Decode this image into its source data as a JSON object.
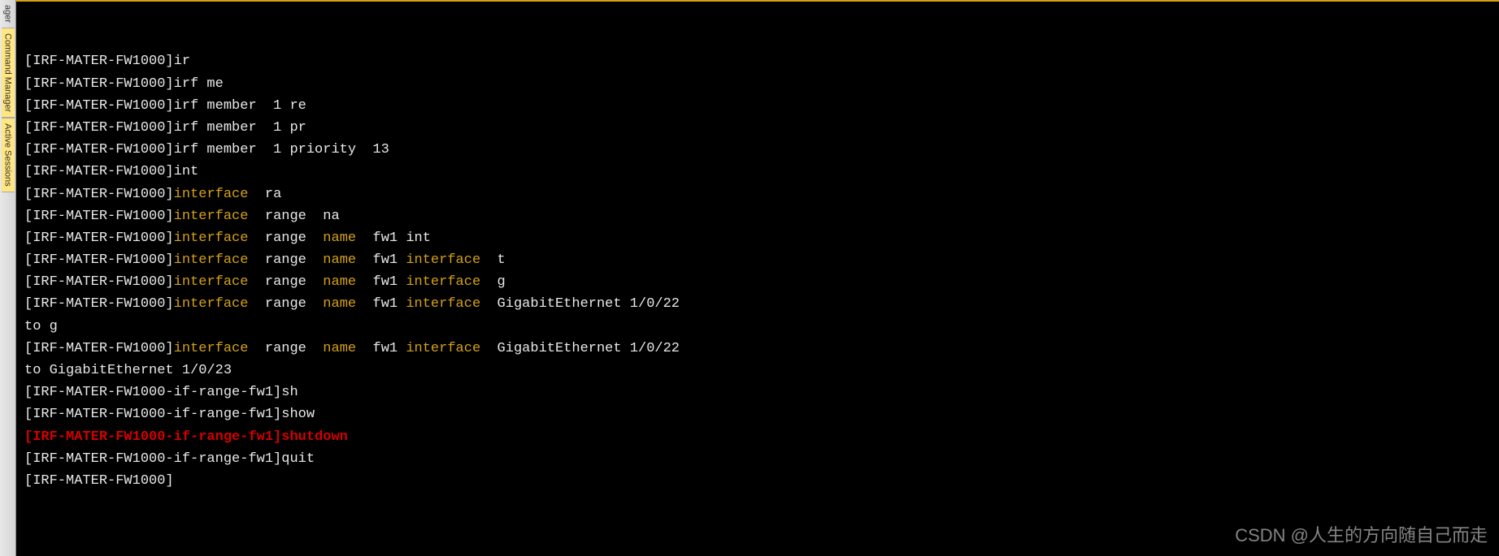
{
  "sidebar": {
    "tabs": [
      {
        "label": "Command Manager",
        "active": true,
        "top_fragment": "ager"
      },
      {
        "label": "Active Sessions",
        "active": true
      }
    ]
  },
  "prompts": {
    "main": "[IRF-MATER-FW1000]",
    "ifrange": "[IRF-MATER-FW1000-if-range-fw1]"
  },
  "terminal": {
    "lines": [
      {
        "segments": [
          {
            "t": "plain",
            "v": "[IRF-MATER-FW1000]ir"
          }
        ]
      },
      {
        "segments": [
          {
            "t": "plain",
            "v": "[IRF-MATER-FW1000]irf me"
          }
        ]
      },
      {
        "segments": [
          {
            "t": "plain",
            "v": "[IRF-MATER-FW1000]irf member  1 re"
          }
        ]
      },
      {
        "segments": [
          {
            "t": "plain",
            "v": "[IRF-MATER-FW1000]irf member  1 pr"
          }
        ]
      },
      {
        "segments": [
          {
            "t": "plain",
            "v": "[IRF-MATER-FW1000]irf member  1 priority  13"
          }
        ]
      },
      {
        "segments": [
          {
            "t": "plain",
            "v": "[IRF-MATER-FW1000]int"
          }
        ]
      },
      {
        "segments": [
          {
            "t": "plain",
            "v": "[IRF-MATER-FW1000]"
          },
          {
            "t": "kw",
            "v": "interface"
          },
          {
            "t": "plain",
            "v": "  ra"
          }
        ]
      },
      {
        "segments": [
          {
            "t": "plain",
            "v": "[IRF-MATER-FW1000]"
          },
          {
            "t": "kw",
            "v": "interface"
          },
          {
            "t": "plain",
            "v": "  range  na"
          }
        ]
      },
      {
        "segments": [
          {
            "t": "plain",
            "v": "[IRF-MATER-FW1000]"
          },
          {
            "t": "kw",
            "v": "interface"
          },
          {
            "t": "plain",
            "v": "  range  "
          },
          {
            "t": "kw",
            "v": "name"
          },
          {
            "t": "plain",
            "v": "  fw1 int"
          }
        ]
      },
      {
        "segments": [
          {
            "t": "plain",
            "v": "[IRF-MATER-FW1000]"
          },
          {
            "t": "kw",
            "v": "interface"
          },
          {
            "t": "plain",
            "v": "  range  "
          },
          {
            "t": "kw",
            "v": "name"
          },
          {
            "t": "plain",
            "v": "  fw1 "
          },
          {
            "t": "kw",
            "v": "interface"
          },
          {
            "t": "plain",
            "v": "  t"
          }
        ]
      },
      {
        "segments": [
          {
            "t": "plain",
            "v": "[IRF-MATER-FW1000]"
          },
          {
            "t": "kw",
            "v": "interface"
          },
          {
            "t": "plain",
            "v": "  range  "
          },
          {
            "t": "kw",
            "v": "name"
          },
          {
            "t": "plain",
            "v": "  fw1 "
          },
          {
            "t": "kw",
            "v": "interface"
          },
          {
            "t": "plain",
            "v": "  g"
          }
        ]
      },
      {
        "segments": [
          {
            "t": "plain",
            "v": "[IRF-MATER-FW1000]"
          },
          {
            "t": "kw",
            "v": "interface"
          },
          {
            "t": "plain",
            "v": "  range  "
          },
          {
            "t": "kw",
            "v": "name"
          },
          {
            "t": "plain",
            "v": "  fw1 "
          },
          {
            "t": "kw",
            "v": "interface"
          },
          {
            "t": "plain",
            "v": "  GigabitEthernet 1/0/22"
          }
        ]
      },
      {
        "segments": [
          {
            "t": "plain",
            "v": "to g"
          }
        ]
      },
      {
        "segments": [
          {
            "t": "plain",
            "v": "[IRF-MATER-FW1000]"
          },
          {
            "t": "kw",
            "v": "interface"
          },
          {
            "t": "plain",
            "v": "  range  "
          },
          {
            "t": "kw",
            "v": "name"
          },
          {
            "t": "plain",
            "v": "  fw1 "
          },
          {
            "t": "kw",
            "v": "interface"
          },
          {
            "t": "plain",
            "v": "  GigabitEthernet 1/0/22"
          }
        ]
      },
      {
        "segments": [
          {
            "t": "plain",
            "v": "to GigabitEthernet 1/0/23"
          }
        ]
      },
      {
        "segments": [
          {
            "t": "plain",
            "v": "[IRF-MATER-FW1000-if-range-fw1]sh"
          }
        ]
      },
      {
        "segments": [
          {
            "t": "plain",
            "v": "[IRF-MATER-FW1000-if-range-fw1]show"
          }
        ]
      },
      {
        "segments": [
          {
            "t": "err",
            "v": "[IRF-MATER-FW1000-if-range-fw1]shutdown"
          }
        ]
      },
      {
        "segments": [
          {
            "t": "plain",
            "v": "[IRF-MATER-FW1000-if-range-fw1]quit"
          }
        ]
      },
      {
        "segments": [
          {
            "t": "plain",
            "v": "[IRF-MATER-FW1000]"
          }
        ]
      }
    ]
  },
  "watermark": "CSDN @人生的方向随自己而走"
}
